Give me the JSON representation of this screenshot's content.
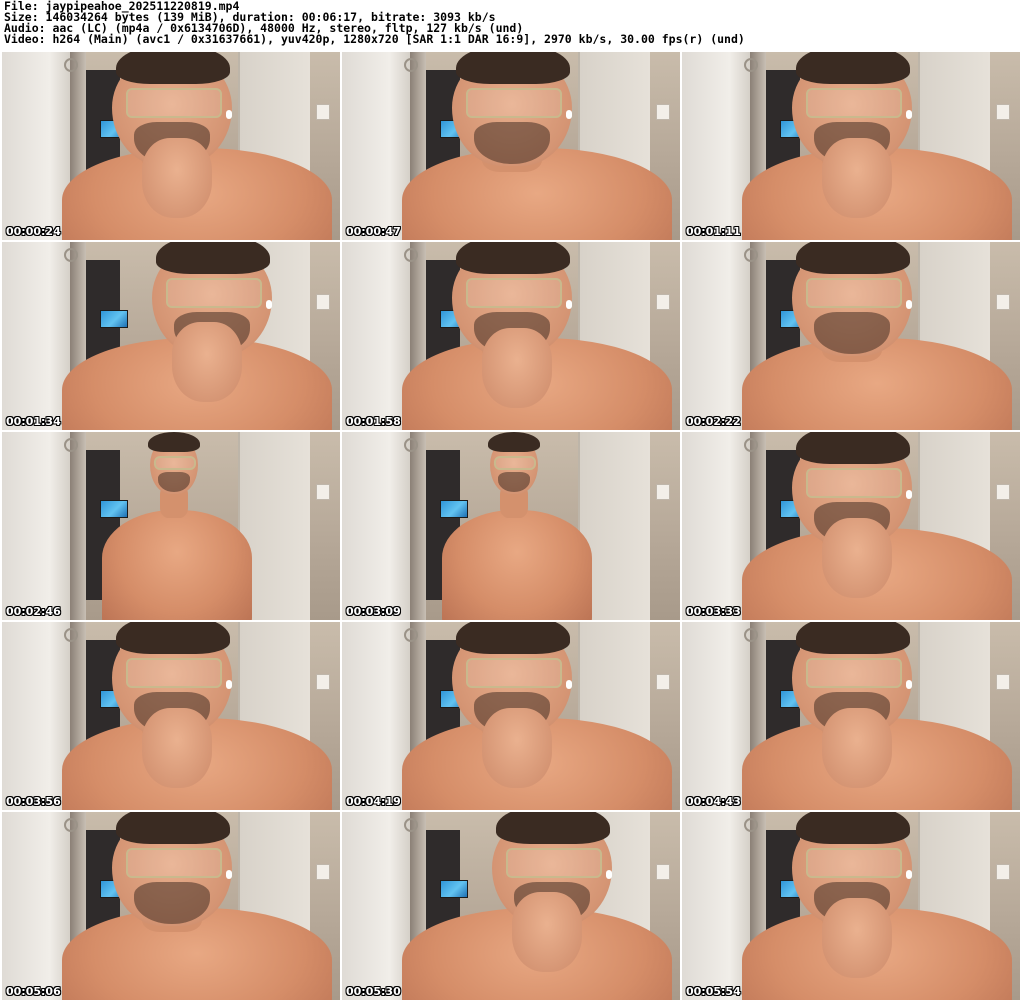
{
  "header": {
    "file_line": "File: jaypipeahoe_202511220819.mp4",
    "size_line": "Size: 146034264 bytes (139 MiB), duration: 00:06:17, bitrate: 3093 kb/s",
    "audio_line": "Audio: aac (LC) (mp4a / 0x6134706D), 48000 Hz, stereo, fltp, 127 kb/s (und)",
    "video_line": "Video: h264 (Main) (avc1 / 0x31637661), yuv420p, 1280x720 [SAR 1:1 DAR 16:9], 2970 kb/s, 30.00 fps(r) (und)"
  },
  "thumbnails": [
    {
      "timestamp": "00:00:24",
      "pose": "hand-chin-close"
    },
    {
      "timestamp": "00:00:47",
      "pose": "close-front"
    },
    {
      "timestamp": "00:01:11",
      "pose": "hand-chin-close"
    },
    {
      "timestamp": "00:01:34",
      "pose": "hand-face-low"
    },
    {
      "timestamp": "00:01:58",
      "pose": "hand-chin-close"
    },
    {
      "timestamp": "00:02:22",
      "pose": "close-front"
    },
    {
      "timestamp": "00:02:46",
      "pose": "far-front"
    },
    {
      "timestamp": "00:03:09",
      "pose": "far-front"
    },
    {
      "timestamp": "00:03:33",
      "pose": "hand-chin-close"
    },
    {
      "timestamp": "00:03:56",
      "pose": "hand-chin-close"
    },
    {
      "timestamp": "00:04:19",
      "pose": "hand-chin-close"
    },
    {
      "timestamp": "00:04:43",
      "pose": "hand-chin-close"
    },
    {
      "timestamp": "00:05:06",
      "pose": "close-front"
    },
    {
      "timestamp": "00:05:30",
      "pose": "hand-face-low"
    },
    {
      "timestamp": "00:05:54",
      "pose": "hand-chin-close"
    }
  ]
}
